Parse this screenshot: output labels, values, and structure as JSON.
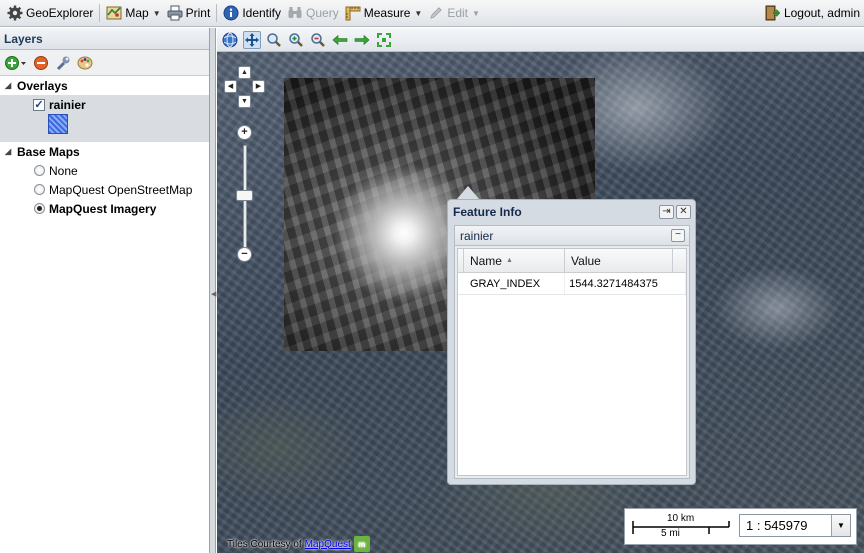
{
  "toolbar": {
    "app_label": "GeoExplorer",
    "map_label": "Map",
    "print_label": "Print",
    "identify_label": "Identify",
    "query_label": "Query",
    "measure_label": "Measure",
    "edit_label": "Edit",
    "logout_label": "Logout, admin"
  },
  "layers": {
    "title": "Layers",
    "overlays_label": "Overlays",
    "overlay_layer": "rainier",
    "basemaps_label": "Base Maps",
    "basemaps": [
      "None",
      "MapQuest OpenStreetMap",
      "MapQuest Imagery"
    ],
    "selected_basemap": "MapQuest Imagery"
  },
  "feature_info": {
    "title": "Feature Info",
    "layer_name": "rainier",
    "columns": [
      "Name",
      "Value"
    ],
    "rows": [
      {
        "name": "GRAY_INDEX",
        "value": "1544.3271484375"
      }
    ]
  },
  "map": {
    "attribution_prefix": "Tiles Courtesy of",
    "attribution_link": "MapQuest",
    "scale_top": "10 km",
    "scale_bottom": "5 mi",
    "scale_value": "1 : 545979"
  },
  "colors": {
    "accent": "#15428b",
    "popup_bg": "#d5dbe2"
  }
}
